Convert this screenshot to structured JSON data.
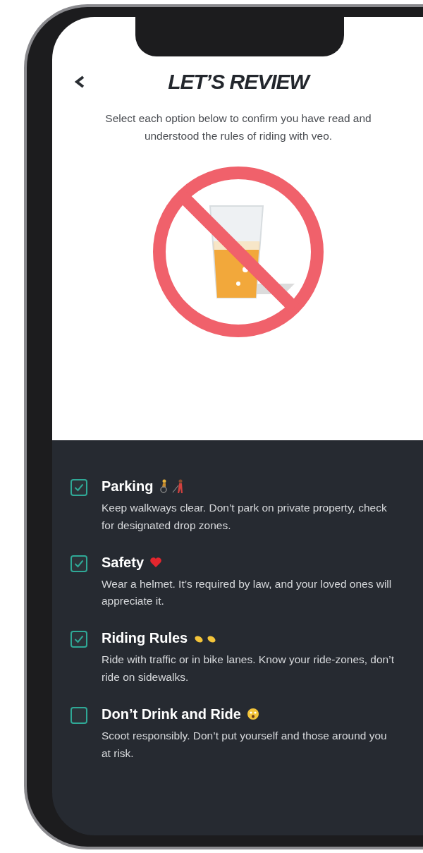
{
  "header": {
    "title": "LET’S REVIEW",
    "subtitle": "Select each option below to confirm you have read and understood the rules of riding with veo."
  },
  "rules": [
    {
      "title": "Parking",
      "description": "Keep walkways clear. Don’t park on private property, check for designated drop zones.",
      "checked": true
    },
    {
      "title": "Safety",
      "description": "Wear a helmet. It’s required by law, and your loved ones will appreciate it.",
      "checked": true
    },
    {
      "title": "Riding Rules",
      "description": "Ride with traffic or in  bike lanes. Know your ride-zones, don’t ride on sidewalks.",
      "checked": true
    },
    {
      "title": "Don’t Drink and Ride",
      "description": "Scoot responsibly. Don’t put yourself and those around you at risk.",
      "checked": false
    }
  ]
}
